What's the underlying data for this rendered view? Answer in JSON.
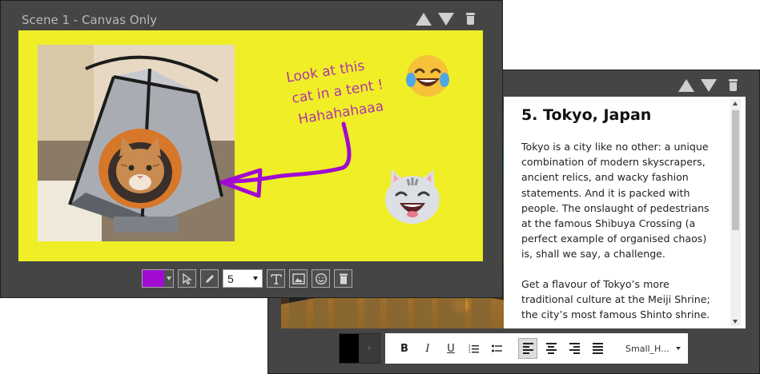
{
  "canvas_scene": {
    "title": "Scene 1 - Canvas Only",
    "canvas_bg": "#f0ee27",
    "ink_color": "#ad36a8",
    "annotation_lines": [
      "Look at this",
      "cat in a tent !",
      "Hahahahaaa"
    ],
    "images": [
      "cat-in-tent-photo"
    ],
    "emojis": [
      "face-with-tears-of-joy-emoji",
      "grinning-cat-emoji"
    ],
    "toolbar": {
      "selected_color": "#a00ad2",
      "brush_size": "5",
      "tools": [
        "select-icon",
        "pencil-icon",
        "text-icon",
        "image-icon",
        "emoji-icon",
        "trash-icon"
      ]
    }
  },
  "text_scene": {
    "article": {
      "title": "5. Tokyo, Japan",
      "paragraphs": [
        "Tokyo is a city like no other: a unique combination of modern skyscrapers, ancient relics, and wacky fashion statements. And it is packed with people. The onslaught of pedestrians at the famous Shibuya Crossing (a perfect example of organised chaos) is, shall we say, a challenge.",
        "Get a flavour of Tokyo’s more traditional culture at the Meiji Shrine; the city’s most famous Shinto shrine."
      ]
    },
    "toolbar": {
      "text_color": "#000000",
      "bold": "B",
      "italic": "I",
      "underline": "U",
      "font_name": "Small_H..."
    }
  }
}
